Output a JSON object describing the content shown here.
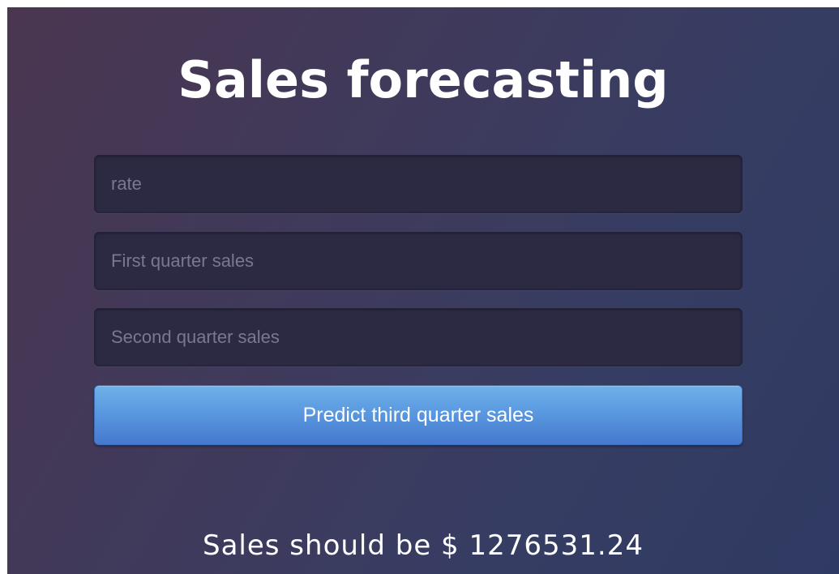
{
  "page": {
    "title": "Sales forecasting"
  },
  "form": {
    "rate": {
      "placeholder": "rate",
      "value": ""
    },
    "first_quarter": {
      "placeholder": "First quarter sales",
      "value": ""
    },
    "second_quarter": {
      "placeholder": "Second quarter sales",
      "value": ""
    },
    "submit_label": "Predict third quarter sales"
  },
  "result": {
    "text": "Sales should be $ 1276531.24"
  },
  "colors": {
    "background_start": "#4a3650",
    "background_end": "#2f3a62",
    "button": "#5896de",
    "input_bg": "#2c2a43"
  }
}
